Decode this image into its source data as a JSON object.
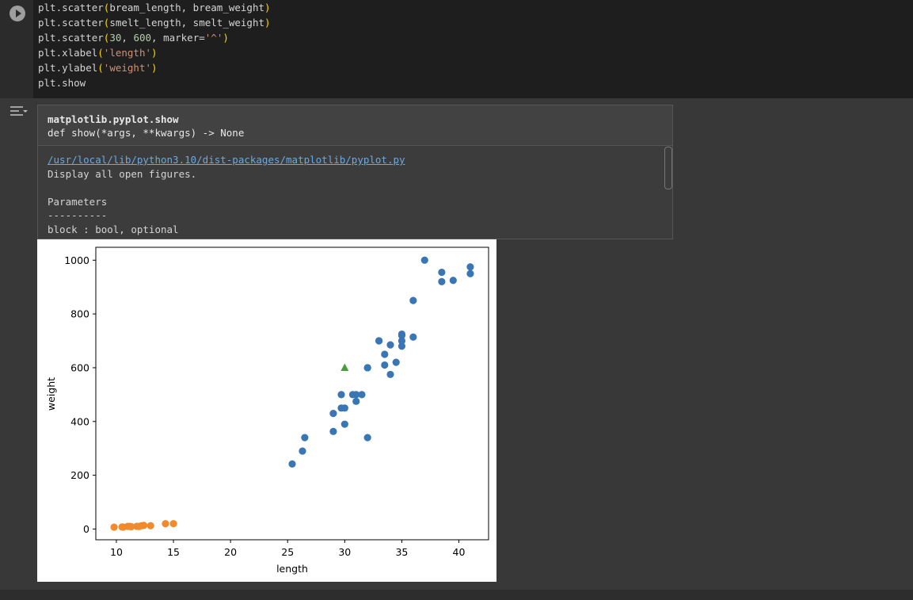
{
  "code_lines": [
    "plt.scatter(bream_length, bream_weight)",
    "plt.scatter(smelt_length, smelt_weight)",
    "plt.scatter(30, 600, marker='^')",
    "plt.xlabel('length')",
    "plt.ylabel('weight')",
    "plt.show"
  ],
  "doc": {
    "title": "matplotlib.pyplot.show",
    "signature": "def show(*args, **kwargs) -> None",
    "path": "/usr/local/lib/python3.10/dist-packages/matplotlib/pyplot.py",
    "summary": "Display all open figures.",
    "params_heading": "Parameters",
    "params_rule": "----------",
    "param1": "block : bool, optional"
  },
  "colors": {
    "bream": "#3a76b4",
    "smelt": "#f08a2c",
    "sample": "#4a9e3f"
  },
  "chart_data": {
    "type": "scatter",
    "xlabel": "length",
    "ylabel": "weight",
    "xlim": [
      8.2,
      42.6
    ],
    "ylim": [
      -40,
      1048
    ],
    "xticks": [
      10,
      15,
      20,
      25,
      30,
      35,
      40
    ],
    "yticks": [
      0,
      200,
      400,
      600,
      800,
      1000
    ],
    "series": [
      {
        "marker": "circle",
        "color": "#3a76b4",
        "x": [
          25.4,
          26.3,
          26.5,
          29.0,
          29.0,
          29.7,
          29.7,
          30.0,
          30.0,
          30.7,
          31.0,
          31.0,
          31.5,
          32.0,
          32.0,
          32.0,
          33.0,
          33.0,
          33.5,
          33.5,
          34.0,
          34.0,
          34.5,
          35.0,
          35.0,
          35.0,
          35.0,
          36.0,
          36.0,
          37.0,
          38.5,
          38.5,
          39.5,
          41.0,
          41.0
        ],
        "y": [
          242,
          290,
          340,
          363,
          430,
          450,
          500,
          390,
          450,
          500,
          475,
          500,
          500,
          340,
          600,
          600,
          700,
          700,
          610,
          650,
          575,
          685,
          620,
          680,
          700,
          725,
          720,
          714,
          850,
          1000,
          920,
          955,
          925,
          975,
          950
        ]
      },
      {
        "marker": "circle",
        "color": "#f08a2c",
        "x": [
          9.8,
          10.5,
          10.6,
          11.0,
          11.2,
          11.3,
          11.8,
          11.8,
          12.0,
          12.2,
          12.4,
          13.0,
          14.3,
          15.0
        ],
        "y": [
          6.7,
          7.5,
          7.0,
          9.7,
          9.8,
          8.7,
          10.0,
          9.9,
          9.8,
          12.2,
          13.4,
          12.2,
          19.7,
          19.9
        ]
      },
      {
        "marker": "triangle",
        "color": "#4a9e3f",
        "x": [
          30
        ],
        "y": [
          600
        ]
      }
    ]
  }
}
